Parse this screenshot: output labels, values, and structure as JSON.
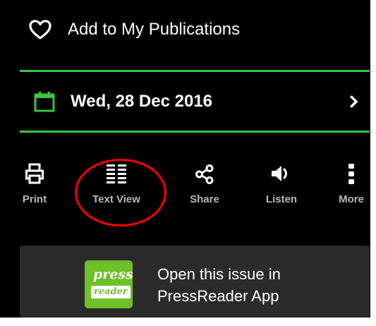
{
  "favorite": {
    "label": "Add to My Publications",
    "icon": "heart-outline-icon"
  },
  "issue_date": {
    "label": "Wed, 28 Dec 2016",
    "icon": "calendar-icon",
    "next_icon": "chevron-right-icon"
  },
  "toolbar": {
    "items": [
      {
        "label": "Print",
        "icon": "printer-icon"
      },
      {
        "label": "Text View",
        "icon": "text-view-icon"
      },
      {
        "label": "Share",
        "icon": "share-icon"
      },
      {
        "label": "Listen",
        "icon": "speaker-icon"
      },
      {
        "label": "More",
        "icon": "more-vertical-icon"
      }
    ]
  },
  "app_promo": {
    "logo_line1": "press",
    "logo_line2": "reader",
    "line1": "Open this issue in",
    "line2": "PressReader App"
  },
  "colors": {
    "background": "#000000",
    "accent_green": "#3cc53c",
    "toolbar_label": "#b8b8b8",
    "card_background": "#2b2b2b",
    "logo_green": "#6fbf2a",
    "annotation_red": "#ff0000"
  }
}
